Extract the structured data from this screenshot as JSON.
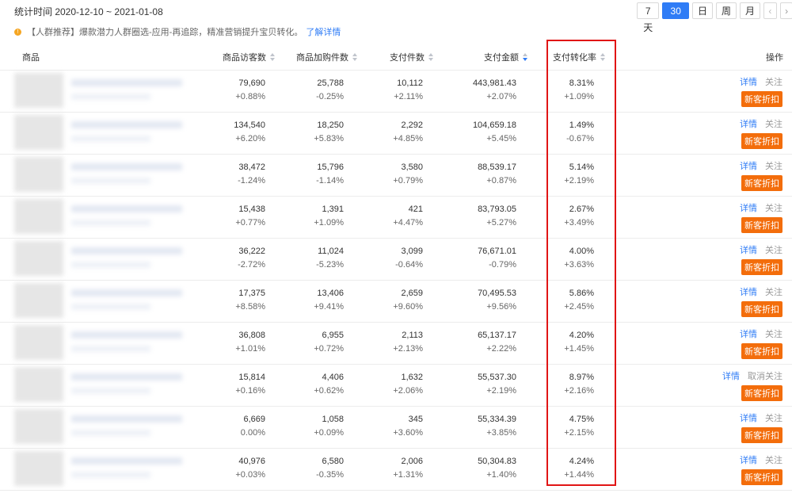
{
  "stat_time": "统计时间 2020-12-10 ~ 2021-01-08",
  "range_buttons": [
    "7天",
    "30天",
    "日",
    "周",
    "月"
  ],
  "active_range": "30天",
  "notice": {
    "text": "【人群推荐】爆款潜力人群圈选-应用-再追踪，精准营销提升宝贝转化。",
    "link": "了解详情"
  },
  "columns": {
    "product": "商品",
    "visitors": "商品访客数",
    "cart": "商品加购件数",
    "pay_qty": "支付件数",
    "pay_amount": "支付金额",
    "conversion": "支付转化率",
    "actions": "操作"
  },
  "rows": [
    {
      "visitors": "79,690",
      "visitors_d": "+0.88%",
      "cart": "25,788",
      "cart_d": "-0.25%",
      "pay_qty": "10,112",
      "pay_qty_d": "+2.11%",
      "amount": "443,981.43",
      "amount_d": "+2.07%",
      "conv": "8.31%",
      "conv_d": "+1.09%",
      "detail": "详情",
      "follow": "关注",
      "promo": "新客折扣"
    },
    {
      "visitors": "134,540",
      "visitors_d": "+6.20%",
      "cart": "18,250",
      "cart_d": "+5.83%",
      "pay_qty": "2,292",
      "pay_qty_d": "+4.85%",
      "amount": "104,659.18",
      "amount_d": "+5.45%",
      "conv": "1.49%",
      "conv_d": "-0.67%",
      "detail": "详情",
      "follow": "关注",
      "promo": "新客折扣"
    },
    {
      "visitors": "38,472",
      "visitors_d": "-1.24%",
      "cart": "15,796",
      "cart_d": "-1.14%",
      "pay_qty": "3,580",
      "pay_qty_d": "+0.79%",
      "amount": "88,539.17",
      "amount_d": "+0.87%",
      "conv": "5.14%",
      "conv_d": "+2.19%",
      "detail": "详情",
      "follow": "关注",
      "promo": "新客折扣"
    },
    {
      "visitors": "15,438",
      "visitors_d": "+0.77%",
      "cart": "1,391",
      "cart_d": "+1.09%",
      "pay_qty": "421",
      "pay_qty_d": "+4.47%",
      "amount": "83,793.05",
      "amount_d": "+5.27%",
      "conv": "2.67%",
      "conv_d": "+3.49%",
      "detail": "详情",
      "follow": "关注",
      "promo": "新客折扣"
    },
    {
      "visitors": "36,222",
      "visitors_d": "-2.72%",
      "cart": "11,024",
      "cart_d": "-5.23%",
      "pay_qty": "3,099",
      "pay_qty_d": "-0.64%",
      "amount": "76,671.01",
      "amount_d": "-0.79%",
      "conv": "4.00%",
      "conv_d": "+3.63%",
      "detail": "详情",
      "follow": "关注",
      "promo": "新客折扣"
    },
    {
      "visitors": "17,375",
      "visitors_d": "+8.58%",
      "cart": "13,406",
      "cart_d": "+9.41%",
      "pay_qty": "2,659",
      "pay_qty_d": "+9.60%",
      "amount": "70,495.53",
      "amount_d": "+9.56%",
      "conv": "5.86%",
      "conv_d": "+2.45%",
      "detail": "详情",
      "follow": "关注",
      "promo": "新客折扣"
    },
    {
      "visitors": "36,808",
      "visitors_d": "+1.01%",
      "cart": "6,955",
      "cart_d": "+0.72%",
      "pay_qty": "2,113",
      "pay_qty_d": "+2.13%",
      "amount": "65,137.17",
      "amount_d": "+2.22%",
      "conv": "4.20%",
      "conv_d": "+1.45%",
      "detail": "详情",
      "follow": "关注",
      "promo": "新客折扣"
    },
    {
      "visitors": "15,814",
      "visitors_d": "+0.16%",
      "cart": "4,406",
      "cart_d": "+0.62%",
      "pay_qty": "1,632",
      "pay_qty_d": "+2.06%",
      "amount": "55,537.30",
      "amount_d": "+2.19%",
      "conv": "8.97%",
      "conv_d": "+2.16%",
      "detail": "详情",
      "follow": "取消关注",
      "promo": "新客折扣"
    },
    {
      "visitors": "6,669",
      "visitors_d": "0.00%",
      "cart": "1,058",
      "cart_d": "+0.09%",
      "pay_qty": "345",
      "pay_qty_d": "+3.60%",
      "amount": "55,334.39",
      "amount_d": "+3.85%",
      "conv": "4.75%",
      "conv_d": "+2.15%",
      "detail": "详情",
      "follow": "关注",
      "promo": "新客折扣"
    },
    {
      "visitors": "40,976",
      "visitors_d": "+0.03%",
      "cart": "6,580",
      "cart_d": "-0.35%",
      "pay_qty": "2,006",
      "pay_qty_d": "+1.31%",
      "amount": "50,304.83",
      "amount_d": "+1.40%",
      "conv": "4.24%",
      "conv_d": "+1.44%",
      "detail": "详情",
      "follow": "关注",
      "promo": "新客折扣"
    }
  ],
  "colors": {
    "accent": "#2f7cf6",
    "promo": "#f36d0b",
    "highlight_box": "#e11515"
  }
}
